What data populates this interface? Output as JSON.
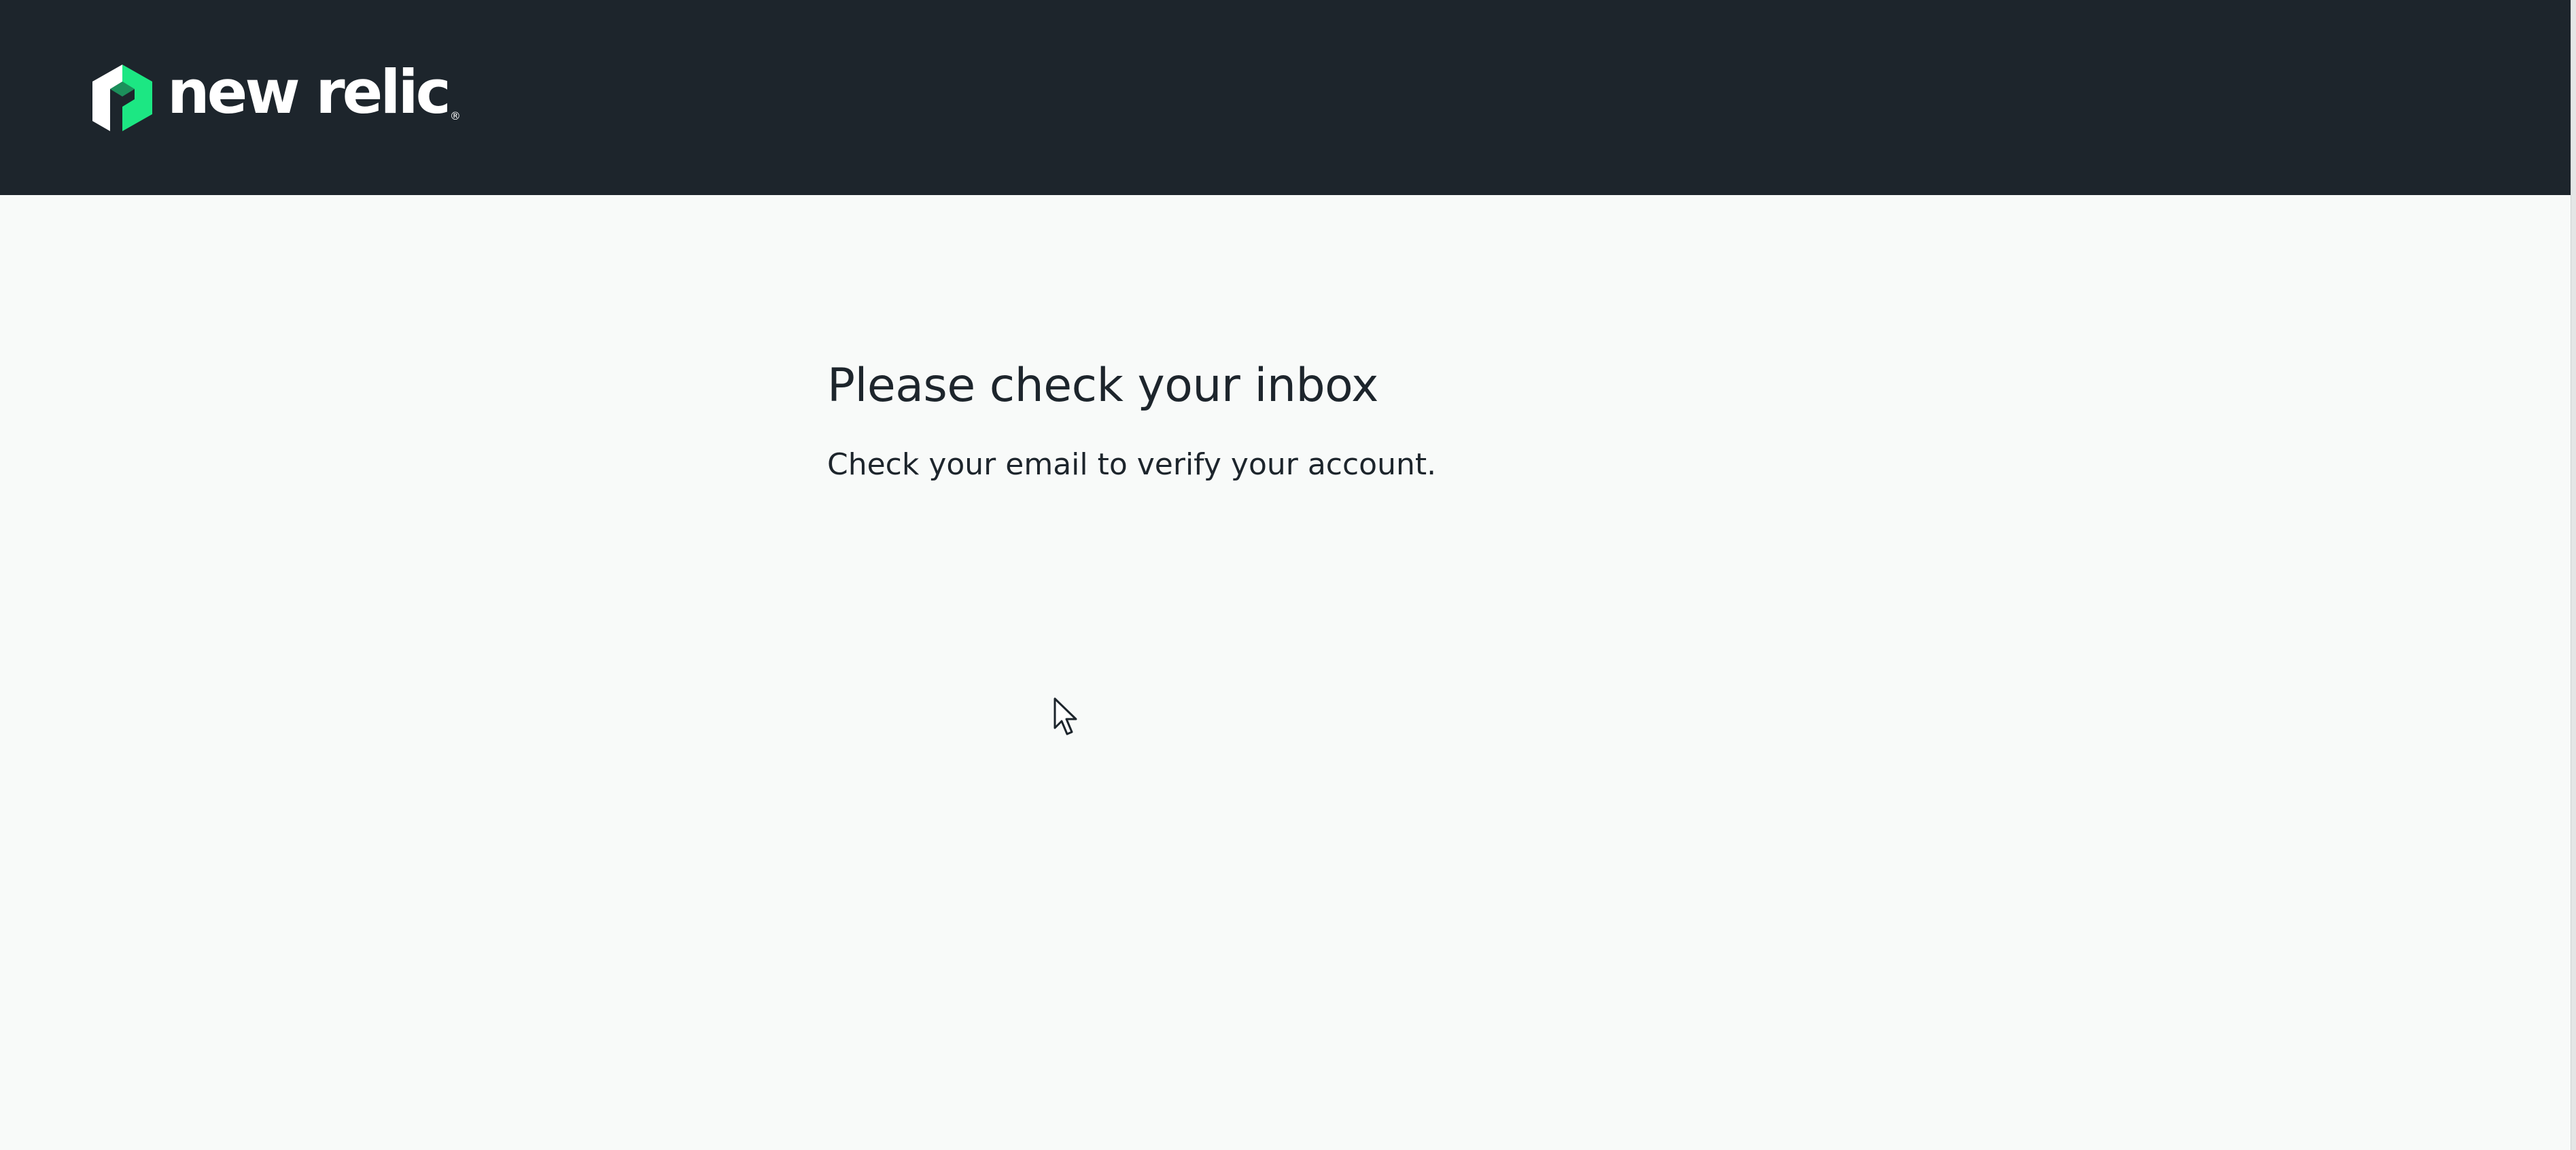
{
  "header": {
    "brand_name": "new relic",
    "brand_mark": "new-relic-hexagon-logo",
    "registered_symbol": "®",
    "background_color": "#1d252c",
    "brand_accent_color": "#1ce783"
  },
  "main": {
    "title": "Please check your inbox",
    "message": "Check your email to verify your account."
  },
  "page": {
    "background_color": "#f8faf9",
    "text_color": "#1d252c"
  },
  "cursor": {
    "icon": "arrow-pointer-icon"
  }
}
